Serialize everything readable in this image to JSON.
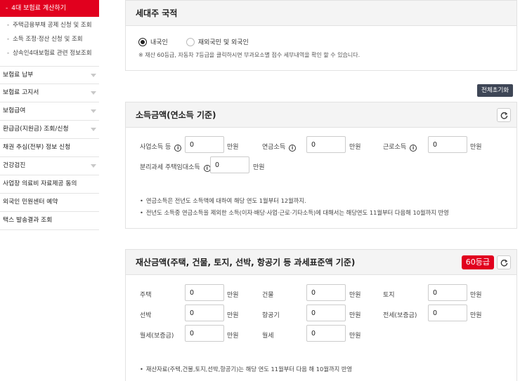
{
  "sidebar": {
    "active": "4대 보험료 계산하기",
    "sub_items": [
      "주택금융부채 공제 신청 및 조회",
      "소득 조정·정산 신청 및 조회",
      "상속인4대보험료 관련 정보조회"
    ],
    "menu": [
      "보험료 납부",
      "보험료 고지서",
      "보험급여",
      "환급금(지원금) 조회/신청",
      "채권 추심(전부) 정보 신청",
      "건강검진",
      "사업장 의료비 자료제공 동의",
      "외국인 민원센터 예약",
      "택스 발송결과 조회"
    ]
  },
  "nationality": {
    "title": "세대주 국적",
    "options": [
      "내국인",
      "재외국민 및 외국인"
    ],
    "selected": "내국인",
    "note": "※ 재산 60등급, 자동차 7등급을 클릭하시면 부과요소별 점수 세부내역을 확인 할 수 있습니다."
  },
  "reset_all_label": "전체초기화",
  "income": {
    "title": "소득금액(연소득 기준)",
    "fields": [
      {
        "label": "사업소득 등",
        "value": "0",
        "unit": "만원"
      },
      {
        "label": "연금소득",
        "value": "0",
        "unit": "만원"
      },
      {
        "label": "근로소득",
        "value": "0",
        "unit": "만원"
      },
      {
        "label": "분리과세 주택임대소득",
        "value": "0",
        "unit": "만원"
      }
    ],
    "notes": [
      "연금소득은 전년도 소득액에 대하여 해당 연도 1월부터 12월까지.",
      "전년도 소득중 연금소득을 제외한 소득(이자·배당·사업·근로·기타소득)에 대해서는 해당연도 11월부터 다음해 10월까지 반영"
    ]
  },
  "property": {
    "title": "재산금액(주택, 건물, 토지, 선박, 항공기 등 과세표준액 기준)",
    "grade": "60등급",
    "fields": [
      {
        "label": "주택",
        "value": "0",
        "unit": "만원"
      },
      {
        "label": "건물",
        "value": "0",
        "unit": "만원"
      },
      {
        "label": "토지",
        "value": "0",
        "unit": "만원"
      },
      {
        "label": "선박",
        "value": "0",
        "unit": "만원"
      },
      {
        "label": "항공기",
        "value": "0",
        "unit": "만원"
      },
      {
        "label": "전세(보증금)",
        "value": "0",
        "unit": "만원"
      },
      {
        "label": "월세(보증금)",
        "value": "0",
        "unit": "만원"
      },
      {
        "label": "월세",
        "value": "0",
        "unit": "만원"
      }
    ],
    "notes": [
      "재산자료(주택,건물,토지,선박,항공기)는 해당 연도 11월부터 다음 해 10월까지 반영"
    ]
  }
}
